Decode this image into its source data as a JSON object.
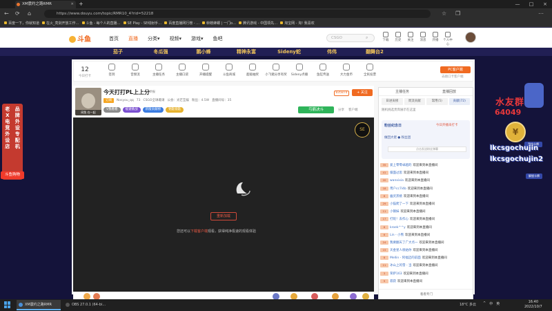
{
  "browser": {
    "tab_title": "XM震约之路RMR",
    "url": "https://www.douyu.com/topic/RMR10_4?rid=52218",
    "bookmarks": [
      "百度一下，你就知道",
      "在火_亮剑开放工作…",
      "斗鱼 - 每个人的直播…",
      "SE Play - SE线射手…",
      "百度直播网行榜 - …",
      "斡螃蜂螺 | 一门o…",
      "腾讯游戏 - 中国领先…",
      "淘宝网 - 淘! 我喜欢"
    ]
  },
  "site": {
    "logo_text": "斗鱼",
    "nav": [
      "首页",
      "直播",
      "分类▾",
      "视频▾",
      "游戏▾",
      "鱼吧"
    ],
    "search_placeholder": "CSGO",
    "header_icons": [
      "下载",
      "历史",
      "关注",
      "消息",
      "开播",
      "个人中心"
    ]
  },
  "streamer_strip": [
    "茄子",
    "冬瓜强",
    "鹅小蜂",
    "精神永富",
    "Sideny蛇",
    "伟伟",
    "翻舞台2"
  ],
  "left_banner": {
    "col1": "老X电竞外设店",
    "col2": "品牌外设专配机",
    "badge": "斗鱼购物"
  },
  "toolbar": {
    "today_count": "12",
    "today_label": "今日打卡",
    "tools": [
      "签到",
      "音频流",
      "主播任务",
      "主播口袋",
      "开播提醒",
      "斗鱼商城",
      "超级抽奖",
      "小飞猪分享有奖",
      "Sideny点播",
      "鱼缸传送",
      "大力金币",
      "全民投票"
    ],
    "pc_button": "PC客户端",
    "pc_link": "去蹭口卡客户端"
  },
  "room": {
    "title": "今天打打PL上上分",
    "report": "举报",
    "thumb_caption": "网鱼 在一起  ",
    "category_tag": "订阅",
    "meta": [
      "Nosyou_qq",
      "73",
      "CSGO全球邀请",
      "公会：光芒互娱",
      "粉丝：4.5W",
      "直播间号：35"
    ],
    "badges": [
      "V我看看",
      "极速挑战",
      "新版贡献榜",
      "钥匙锁匙"
    ],
    "rank_label": "835874",
    "follow_label": "+ 关注",
    "bet_label": "弓箭决斗",
    "share_items": [
      "分享",
      "客户端"
    ]
  },
  "video": {
    "play_button": "重新加载",
    "message_prefix": "您还可以",
    "message_link": "下载客户端",
    "message_suffix": "观看，获得纯净极速的观看体验",
    "corner_logo": "SE"
  },
  "chat": {
    "header": [
      "主播任务",
      "直播回放"
    ],
    "tabs": [
      "日进贡榜",
      "周流贡献",
      "常用(5)",
      "贡献(72)"
    ],
    "note": "随机挑选贵宾展示在这里",
    "fans_title": "粉丝纪念日",
    "fans_right": "今日开播未打卡",
    "fans_row": "做回大佬 ● 粉丝团",
    "fans_input": "点击发送粉丝弹幕",
    "messages": [
      {
        "lv": "35",
        "name": "爱上零零卓越的",
        "text": "欢迎来到本直播间"
      },
      {
        "lv": "41",
        "name": "僵面过思",
        "text": "欢迎来到本直播间"
      },
      {
        "lv": "20",
        "name": "wanxixia",
        "text": "欢迎来到本直播间"
      },
      {
        "lv": "18",
        "name": "用户cc7i4b",
        "text": "欢迎来到本直播间"
      },
      {
        "lv": "8",
        "name": "幽灵黑桃",
        "text": "欢迎来到本直播间"
      },
      {
        "lv": "29",
        "name": "小猫爬了一下",
        "text": "欢迎来到本直播间"
      },
      {
        "lv": "11",
        "name": "小钢妹",
        "text": "欢迎来到本直播间"
      },
      {
        "lv": "17",
        "name": "打蛇！去作心",
        "text": "欢迎来到本直播间"
      },
      {
        "lv": "8",
        "name": "kroek^^y",
        "text": "欢迎来到本直播间"
      },
      {
        "lv": "6",
        "name": "Lin - 小熊",
        "text": "欢迎来到本直播间"
      },
      {
        "lv": "24",
        "name": "我要翻天了广大点一",
        "text": "欢迎来到本直播间"
      },
      {
        "lv": "15",
        "name": "天金星人很姑你",
        "text": "欢迎来到本直播间"
      },
      {
        "lv": "8",
        "name": "Mellin - 阿福迈的前面",
        "text": "欢迎来到本直播间"
      },
      {
        "lv": "11",
        "name": "冰山上的雪 - 当",
        "text": "欢迎来到本直播间"
      },
      {
        "lv": "3",
        "name": "荣萨163",
        "text": "欢迎来到本直播间"
      },
      {
        "lv": "9",
        "name": "寂寂",
        "text": "欢迎来到本直播间"
      }
    ],
    "footer": "看看专门"
  },
  "overlay": {
    "line1": "水友群",
    "line2": "64049",
    "line3": "lkcsgochujin",
    "line4": "lkcsgochujin2",
    "medal": "¥",
    "btn1": "我的卡牌",
    "btn2": "解锁卡牌"
  },
  "taskbar": {
    "task1": "XM震约之路RMR",
    "task2": "OBS 27.0.1 (64-bi…",
    "weather": "18°C 多云",
    "time": "16:40",
    "date": "2022/10/7",
    "tray": [
      "^",
      "中",
      "英"
    ]
  }
}
